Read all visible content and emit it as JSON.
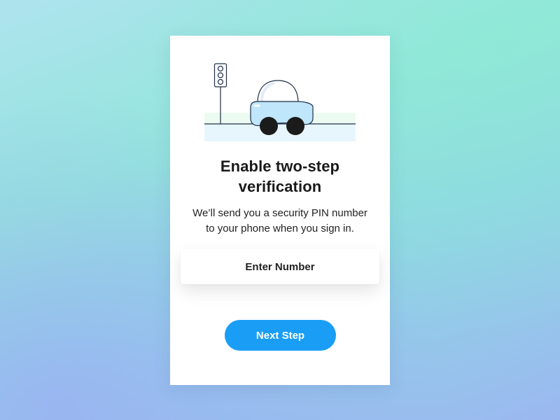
{
  "card": {
    "title_line1": "Enable two-step",
    "title_line2": "verification",
    "subtitle_line1": "We’ll send you a security PIN number",
    "subtitle_line2": "to your phone when you sign in.",
    "input_label": "Enter Number",
    "next_button_label": "Next Step"
  },
  "illustration": {
    "icons": [
      "traffic-light-icon",
      "car-icon"
    ]
  },
  "colors": {
    "accent": "#1a9ef5",
    "card_background": "#ffffff",
    "text": "#1a1a1a"
  }
}
